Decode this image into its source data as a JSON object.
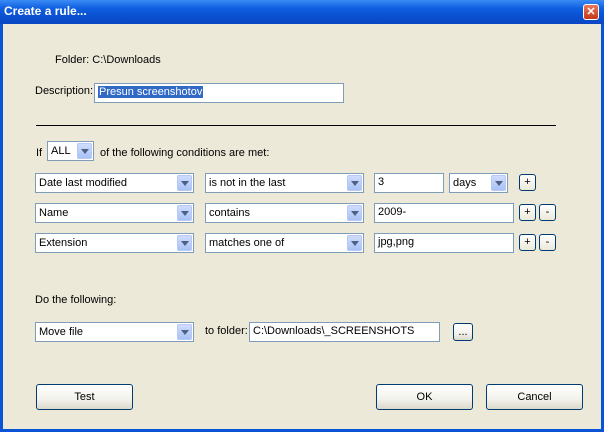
{
  "window": {
    "title": "Create a rule...",
    "close_glyph": "✕"
  },
  "folder": {
    "text": "Folder: C:\\Downloads"
  },
  "description": {
    "label": "Description:",
    "value": "Presun screenshotov"
  },
  "condition_header": {
    "prefix": "If",
    "match_value": "ALL",
    "suffix": "of the following conditions are met:"
  },
  "conditions": [
    {
      "field": "Date last modified",
      "operator": "is not in the last",
      "value": "3",
      "unit": "days"
    },
    {
      "field": "Name",
      "operator": "contains",
      "value": "2009-"
    },
    {
      "field": "Extension",
      "operator": "matches one of",
      "value": "jpg,png"
    }
  ],
  "row_buttons": {
    "add": "+",
    "remove": "-"
  },
  "action": {
    "label": "Do the following:",
    "value": "Move file",
    "to_folder_label": "to folder:",
    "to_folder_value": "C:\\Downloads\\_SCREENSHOTS",
    "browse": "..."
  },
  "buttons": {
    "test": "Test",
    "ok": "OK",
    "cancel": "Cancel"
  }
}
